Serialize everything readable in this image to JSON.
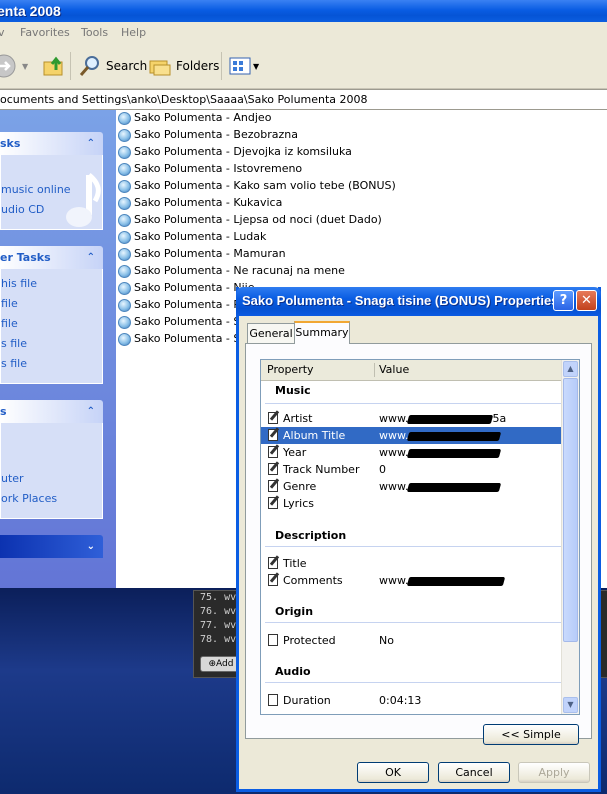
{
  "explorer": {
    "title": "enta 2008",
    "menu": [
      "v",
      "Favorites",
      "Tools",
      "Help"
    ],
    "toolbar": {
      "search": "Search",
      "folders": "Folders"
    },
    "address": "ocuments and Settings\\anko\\Desktop\\Saaaa\\Sako Polumenta 2008"
  },
  "left_pane": {
    "sections": [
      {
        "header": "sks",
        "links": [
          "music online",
          "udio CD"
        ]
      },
      {
        "header": "er Tasks",
        "links": [
          "his file",
          "file",
          "file",
          "s file",
          "s file"
        ]
      },
      {
        "header": "s",
        "links": [
          "uter",
          "ork Places"
        ]
      },
      {
        "header": "",
        "links": []
      }
    ]
  },
  "files": [
    "Sako Polumenta - Andjeo",
    "Sako Polumenta - Bezobrazna",
    "Sako Polumenta - Djevojka iz komsiluka",
    "Sako Polumenta - Istovremeno",
    "Sako Polumenta - Kako sam volio tebe (BONUS)",
    "Sako Polumenta - Kukavica",
    "Sako Polumenta - Ljepsa od noci (duet Dado)",
    "Sako Polumenta - Ludak",
    "Sako Polumenta - Mamuran",
    "Sako Polumenta - Ne racunaj na mene",
    "Sako Polumenta - Nije",
    "Sako Polumenta - Put",
    "Sako Polumenta - San",
    "Sako Polumenta - Sna"
  ],
  "player": {
    "lines": [
      "75. wv",
      "76. wv",
      "77. wv",
      "78. wv"
    ],
    "add_label": "Add"
  },
  "dialog": {
    "title": "Sako Polumenta - Snaga tisine (BONUS) Properties",
    "tabs": [
      "General",
      "Summary"
    ],
    "columns": {
      "property": "Property",
      "value": "Value"
    },
    "groups": {
      "music": "Music",
      "description": "Description",
      "origin": "Origin",
      "audio": "Audio"
    },
    "rows": {
      "artist": {
        "name": "Artist",
        "value": "www.",
        "tail": "5a"
      },
      "album": {
        "name": "Album Title",
        "value": "www."
      },
      "year": {
        "name": "Year",
        "value": "www."
      },
      "track": {
        "name": "Track Number",
        "value": "0"
      },
      "genre": {
        "name": "Genre",
        "value": "www."
      },
      "lyrics": {
        "name": "Lyrics",
        "value": ""
      },
      "title": {
        "name": "Title",
        "value": ""
      },
      "comments": {
        "name": "Comments",
        "value": "www."
      },
      "protected": {
        "name": "Protected",
        "value": "No"
      },
      "duration": {
        "name": "Duration",
        "value": "0:04:13"
      }
    },
    "buttons": {
      "simple": "<< Simple",
      "ok": "OK",
      "cancel": "Cancel",
      "apply": "Apply"
    }
  }
}
